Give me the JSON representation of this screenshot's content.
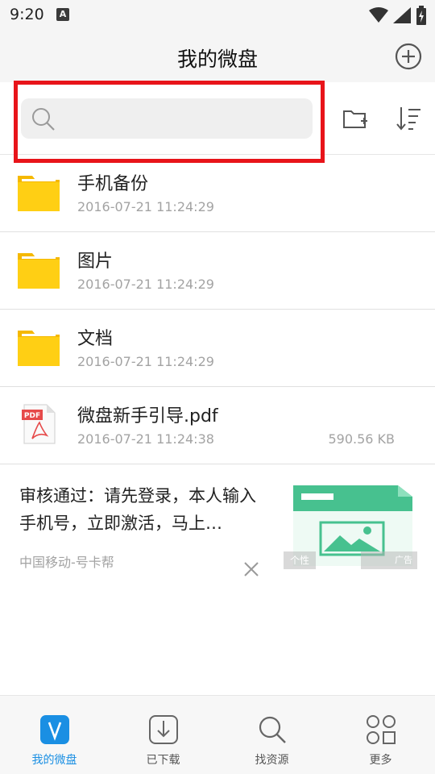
{
  "status_bar": {
    "time": "9:20",
    "notif_letter": "A"
  },
  "header": {
    "title": "我的微盘"
  },
  "search": {
    "placeholder": "",
    "value": ""
  },
  "files": [
    {
      "name": "手机备份",
      "date": "2016-07-21 11:24:29",
      "size": "",
      "type": "folder"
    },
    {
      "name": "图片",
      "date": "2016-07-21 11:24:29",
      "size": "",
      "type": "folder"
    },
    {
      "name": "文档",
      "date": "2016-07-21 11:24:29",
      "size": "",
      "type": "folder"
    },
    {
      "name": "微盘新手引导.pdf",
      "date": "2016-07-21 11:24:38",
      "size": "590.56 KB",
      "type": "pdf"
    }
  ],
  "ad": {
    "text": "审核通过：请先登录，本人输入手机号，立即激活，马上…",
    "source": "中国移动-号卡帮",
    "tag_left": "个性",
    "tag_right": "广告"
  },
  "bottom_nav": [
    {
      "label": "我的微盘",
      "icon": "v-disk-icon",
      "active": true
    },
    {
      "label": "已下载",
      "icon": "download-icon",
      "active": false
    },
    {
      "label": "找资源",
      "icon": "search-icon",
      "active": false
    },
    {
      "label": "更多",
      "icon": "more-grid-icon",
      "active": false
    }
  ],
  "colors": {
    "accent": "#1a8fe3",
    "folder": "#f9c512",
    "highlight": "#e8141a",
    "pdf_red": "#e64a4a"
  }
}
